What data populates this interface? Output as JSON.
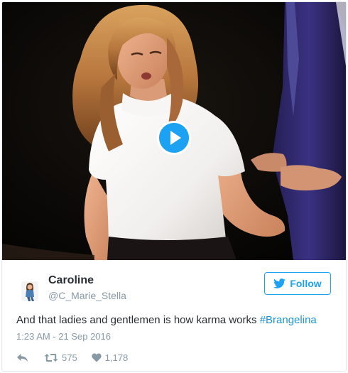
{
  "tweet": {
    "name": "Caroline",
    "handle": "@C_Marie_Stella",
    "follow_label": "Follow",
    "text": "And that ladies and gentlemen is how karma works ",
    "hashtag": "#Brangelina",
    "timestamp": "1:23 AM - 21 Sep 2016",
    "retweets": "575",
    "likes": "1,178"
  },
  "icons": {
    "play": "play-icon",
    "follow": "twitter-bird-icon",
    "reply": "reply-icon",
    "retweet": "retweet-icon",
    "like": "heart-icon"
  },
  "colors": {
    "accent": "#1da1f2",
    "hashtag": "#1b95e0",
    "meta_text": "#8899a6",
    "body_text": "#292f33"
  }
}
